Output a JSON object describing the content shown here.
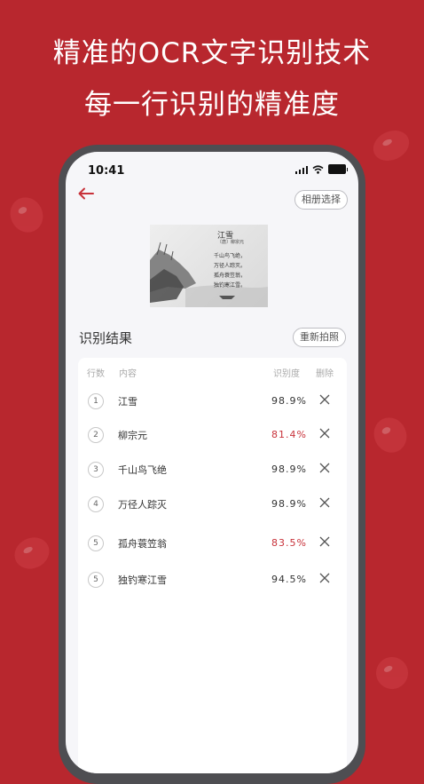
{
  "promo": {
    "line1": "精准的OCR文字识别技术",
    "line2": "每一行识别的精准度"
  },
  "status": {
    "time": "10:41"
  },
  "header": {
    "album_label": "相册选择"
  },
  "photo": {
    "title": "江雪",
    "author": "〔唐〕柳宗元",
    "lines": [
      "千山鸟飞绝，",
      "万径人踪灭。",
      "孤舟蓑笠翁，",
      "独钓寒江雪。"
    ]
  },
  "results": {
    "title": "识别结果",
    "retake_label": "重新拍照",
    "columns": {
      "line": "行数",
      "content": "内容",
      "accuracy": "识别度",
      "delete": "删除"
    },
    "rows": [
      {
        "num": "1",
        "text": "江雪",
        "accuracy": "98.9%"
      },
      {
        "num": "2",
        "text": "柳宗元",
        "accuracy": "81.4%"
      },
      {
        "num": "3",
        "text": "千山鸟飞绝",
        "accuracy": "98.9%"
      },
      {
        "num": "4",
        "text": "万径人踪灭",
        "accuracy": "98.9%"
      },
      {
        "num": "5",
        "text": "孤舟蓑笠翁",
        "accuracy": "83.5%"
      },
      {
        "num": "5",
        "text": "独钓寒江雪",
        "accuracy": "94.5%"
      }
    ]
  },
  "colors": {
    "background": "#b8272e",
    "accent": "#c8323a"
  }
}
